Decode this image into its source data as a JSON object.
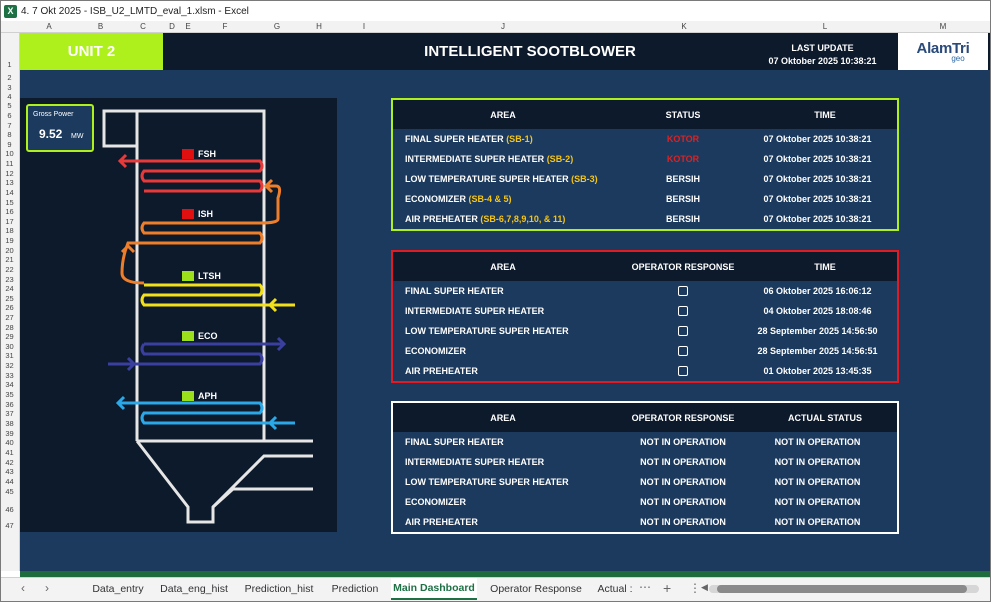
{
  "window": {
    "title": "4. 7 Okt 2025 - ISB_U2_LMTD_eval_1.xlsm  -  Excel"
  },
  "columns": [
    "A",
    "B",
    "C",
    "D",
    "E",
    "F",
    "G",
    "H",
    "I",
    "J",
    "K",
    "L",
    "M"
  ],
  "rows": [
    "1",
    "2",
    "3",
    "4",
    "5",
    "6",
    "7",
    "8",
    "9",
    "10",
    "11",
    "12",
    "13",
    "14",
    "15",
    "16",
    "17",
    "18",
    "19",
    "20",
    "21",
    "22",
    "23",
    "24",
    "25",
    "26",
    "27",
    "28",
    "29",
    "30",
    "31",
    "32",
    "33",
    "34",
    "35",
    "36",
    "37",
    "38",
    "39",
    "40",
    "41",
    "42",
    "43",
    "44",
    "45",
    "46",
    "47"
  ],
  "header": {
    "unit": "UNIT 2",
    "title": "INTELLIGENT SOOTBLOWER",
    "last_update_label": "LAST UPDATE",
    "last_update_value": "07 Oktober 2025 10:38:21",
    "logo_main": "AlamTri",
    "logo_sub": "geo"
  },
  "gross_power": {
    "label": "Gross Power",
    "value": "9.52",
    "unit": "MW"
  },
  "boiler": {
    "sections": [
      {
        "label": "FSH",
        "status_color": "#e01010"
      },
      {
        "label": "ISH",
        "status_color": "#e01010"
      },
      {
        "label": "LTSH",
        "status_color": "#9be01b"
      },
      {
        "label": "ECO",
        "status_color": "#9be01b"
      },
      {
        "label": "APH",
        "status_color": "#9be01b"
      }
    ]
  },
  "status_table": {
    "border_color": "#aef01b",
    "headers": [
      "AREA",
      "STATUS",
      "TIME"
    ],
    "rows": [
      {
        "area": "FINAL SUPER HEATER ",
        "tag": "(SB-1)",
        "status": "KOTOR",
        "status_color": "#e02020",
        "time": "07 Oktober 2025 10:38:21"
      },
      {
        "area": "INTERMEDIATE SUPER HEATER ",
        "tag": "(SB-2)",
        "status": "KOTOR",
        "status_color": "#e02020",
        "time": "07 Oktober 2025 10:38:21"
      },
      {
        "area": "LOW TEMPERATURE SUPER HEATER ",
        "tag": "(SB-3)",
        "status": "BERSIH",
        "status_color": "#ffffff",
        "time": "07 Oktober 2025 10:38:21"
      },
      {
        "area": "ECONOMIZER ",
        "tag": "(SB-4 & 5)",
        "status": "BERSIH",
        "status_color": "#ffffff",
        "time": "07 Oktober 2025 10:38:21"
      },
      {
        "area": "AIR PREHEATER ",
        "tag": "(SB-6,7,8,9,10, & 11)",
        "status": "BERSIH",
        "status_color": "#ffffff",
        "time": "07 Oktober 2025 10:38:21"
      }
    ]
  },
  "operator_table": {
    "border_color": "#e01b24",
    "headers": [
      "AREA",
      "OPERATOR RESPONSE",
      "TIME"
    ],
    "rows": [
      {
        "area": "FINAL SUPER HEATER",
        "checked": false,
        "time": "06 Oktober 2025 16:06:12"
      },
      {
        "area": "INTERMEDIATE SUPER HEATER",
        "checked": false,
        "time": "04 Oktober 2025 18:08:46"
      },
      {
        "area": "LOW TEMPERATURE SUPER HEATER",
        "checked": false,
        "time": "28 September 2025 14:56:50"
      },
      {
        "area": "ECONOMIZER",
        "checked": false,
        "time": "28 September 2025 14:56:51"
      },
      {
        "area": "AIR PREHEATER",
        "checked": false,
        "time": "01 Oktober 2025 13:45:35"
      }
    ]
  },
  "actual_table": {
    "border_color": "#ffffff",
    "headers": [
      "AREA",
      "OPERATOR RESPONSE",
      "ACTUAL STATUS"
    ],
    "rows": [
      {
        "area": "FINAL SUPER HEATER",
        "response": "NOT IN OPERATION",
        "actual": "NOT IN OPERATION"
      },
      {
        "area": "INTERMEDIATE SUPER HEATER",
        "response": "NOT IN OPERATION",
        "actual": "NOT IN OPERATION"
      },
      {
        "area": "LOW TEMPERATURE SUPER HEATER",
        "response": "NOT IN OPERATION",
        "actual": "NOT IN OPERATION"
      },
      {
        "area": "ECONOMIZER",
        "response": "NOT IN OPERATION",
        "actual": "NOT IN OPERATION"
      },
      {
        "area": "AIR PREHEATER",
        "response": "NOT IN OPERATION",
        "actual": "NOT IN OPERATION"
      }
    ]
  },
  "tabs": [
    {
      "label": "Data_entry",
      "active": false
    },
    {
      "label": "Data_eng_hist",
      "active": false
    },
    {
      "label": "Prediction_hist",
      "active": false
    },
    {
      "label": "Prediction",
      "active": false
    },
    {
      "label": "Main Dashboard",
      "active": true
    },
    {
      "label": "Operator Response",
      "active": false
    },
    {
      "label": "Actual :",
      "active": false
    }
  ],
  "tabbar_icons": [
    "chevron-left-icon",
    "chevron-right-icon",
    "more-sheets-icon",
    "add-sheet-icon",
    "options-icon"
  ],
  "colors": {
    "accent_green": "#aef01b",
    "panel_dark": "#0d1a2b",
    "sheet_bg": "#1c3a5e",
    "tag_yellow": "#f5c518"
  }
}
